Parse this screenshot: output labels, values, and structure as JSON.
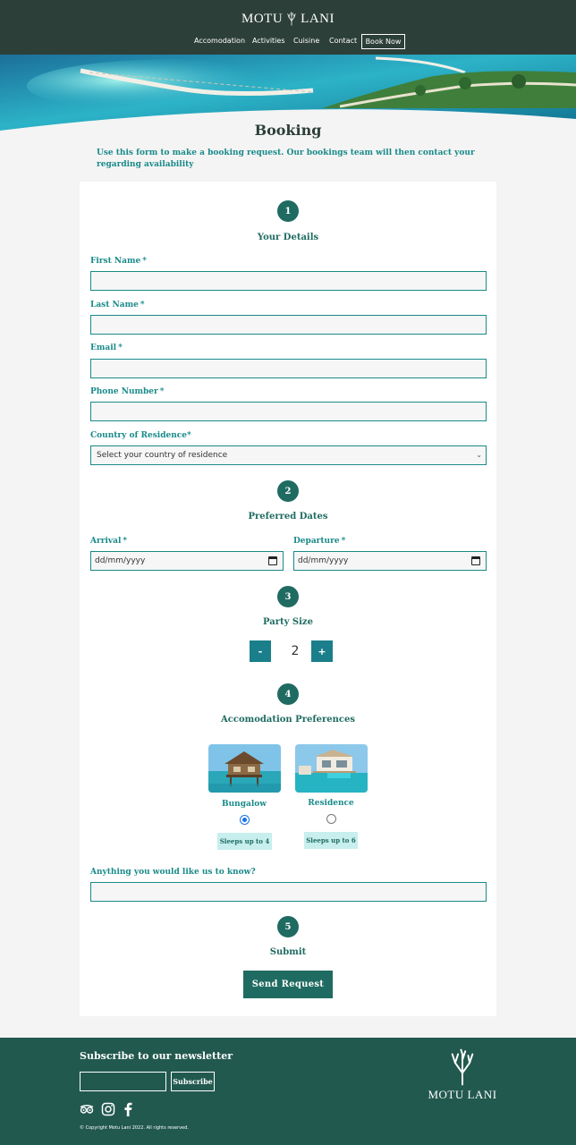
{
  "brand": {
    "name_left": "MOTU",
    "name_right": "LANI",
    "full": "MOTU LANI"
  },
  "nav": {
    "items": [
      "Accomodation",
      "Activities",
      "Cuisine",
      "Contact"
    ],
    "cta": "Book Now"
  },
  "page": {
    "title": "Booking",
    "intro": "Use this form to make a booking request. Our bookings team will then contact your regarding availability"
  },
  "steps": {
    "details": {
      "number": "1",
      "title": "Your Details"
    },
    "dates": {
      "number": "2",
      "title": "Preferred Dates"
    },
    "party": {
      "number": "3",
      "title": "Party Size"
    },
    "accom": {
      "number": "4",
      "title": "Accomodation Preferences"
    },
    "submit": {
      "number": "5",
      "title": "Submit"
    }
  },
  "form": {
    "first_name_label": "First Name",
    "last_name_label": "Last Name",
    "email_label": "Email",
    "phone_label": "Phone Number",
    "country_label": "Country of Residence",
    "required_mark": "*",
    "country_placeholder": "Select your country of residence",
    "arrival_label": "Arrival",
    "departure_label": "Departure",
    "date_placeholder": "dd/mm/yyyy",
    "party_minus": "-",
    "party_plus": "+",
    "party_value": "2",
    "accom_options": [
      {
        "name": "Bungalow",
        "sleeps": "Sleeps up to 4",
        "selected": true
      },
      {
        "name": "Residence",
        "sleeps": "Sleeps up to 6",
        "selected": false
      }
    ],
    "notes_label": "Anything you would like us to know?",
    "send_label": "Send Request"
  },
  "footer": {
    "newsletter_title": "Subscribe to our newsletter",
    "subscribe_label": "Subscribe",
    "copyright": "© Copyright Motu Lani 2022. All rights reserved.",
    "social_icons": [
      "tripadvisor-icon",
      "instagram-icon",
      "facebook-icon"
    ]
  },
  "colors": {
    "header_bg": "#2d3f39",
    "brand_teal": "#1f6b61",
    "accent_teal": "#1a8a8a",
    "footer_bg": "#22594f",
    "sleeps_badge": "#c8eeee"
  }
}
